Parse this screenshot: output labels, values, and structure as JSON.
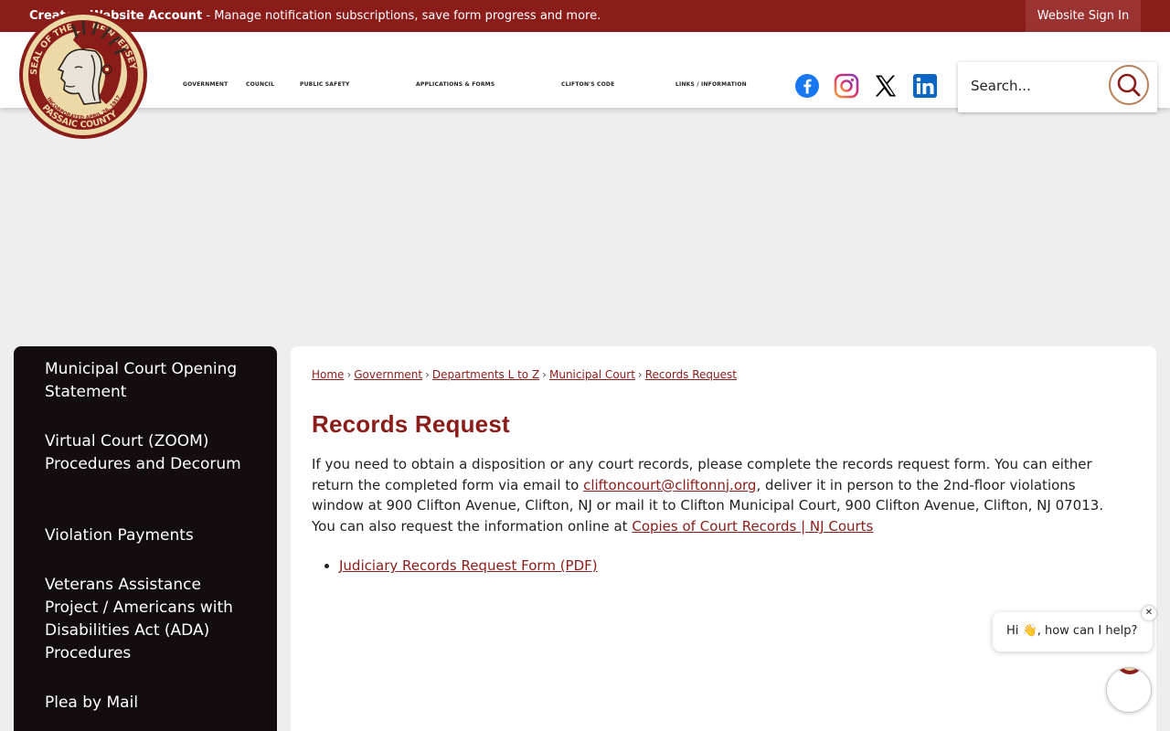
{
  "topbar": {
    "create_account": "Create a Website Account",
    "create_account_desc": " - Manage notification subscriptions, save form progress and more.",
    "sign_in": "Website Sign In"
  },
  "seal": {
    "top_text": "SEAL OF THE",
    "top_text_right": "NEW JERSEY",
    "incorporated": "INCORPORATED APRIL 26, 1917",
    "county": "PASSAIC COUNTY"
  },
  "nav": {
    "items": [
      "GOVERNMENT",
      "COUNCIL",
      "PUBLIC SAFETY",
      "APPLICATIONS & FORMS",
      "CLIFTON'S CODE",
      "LINKS / INFORMATION"
    ]
  },
  "social": {
    "icons": [
      "facebook-icon",
      "instagram-icon",
      "x-icon",
      "linkedin-icon"
    ],
    "colors": {
      "facebook": "#1877f2",
      "linkedin": "#0a66c2",
      "x": "#000000"
    }
  },
  "search": {
    "placeholder": "Search..."
  },
  "sidebar": {
    "items": [
      "Municipal Court Opening Statement",
      "Virtual Court (ZOOM) Procedures and Decorum",
      "Violation Payments",
      "Veterans Assistance Project / Americans with Disabilities Act (ADA) Procedures",
      "Plea by Mail"
    ]
  },
  "breadcrumb": {
    "items": [
      "Home",
      "Government",
      "Departments L to Z",
      "Municipal Court",
      "Records Request"
    ],
    "separator": "›"
  },
  "main": {
    "title": "Records Request",
    "p1": "If you need to obtain a disposition or any court records, please complete the records request form. You can either return the completed form via email to ",
    "email": "cliftoncourt@cliftonnj.org",
    "p2": ", deliver it in person to the 2nd-floor violations window at 900 Clifton Avenue, Clifton, NJ or mail it to Clifton Municipal Court, 900 Clifton Avenue, Clifton, NJ 07013.  You can also request the information online at ",
    "online_link": "Copies of Court Records | NJ Courts",
    "documents": [
      "Judiciary Records Request Form (PDF)"
    ]
  },
  "chat": {
    "greeting": "Hi 👋, how can I help?",
    "close": "✕"
  },
  "colors": {
    "brand": "#8a1c1a",
    "sidebar_bg": "#130d10",
    "page_bg": "#efeeee"
  }
}
